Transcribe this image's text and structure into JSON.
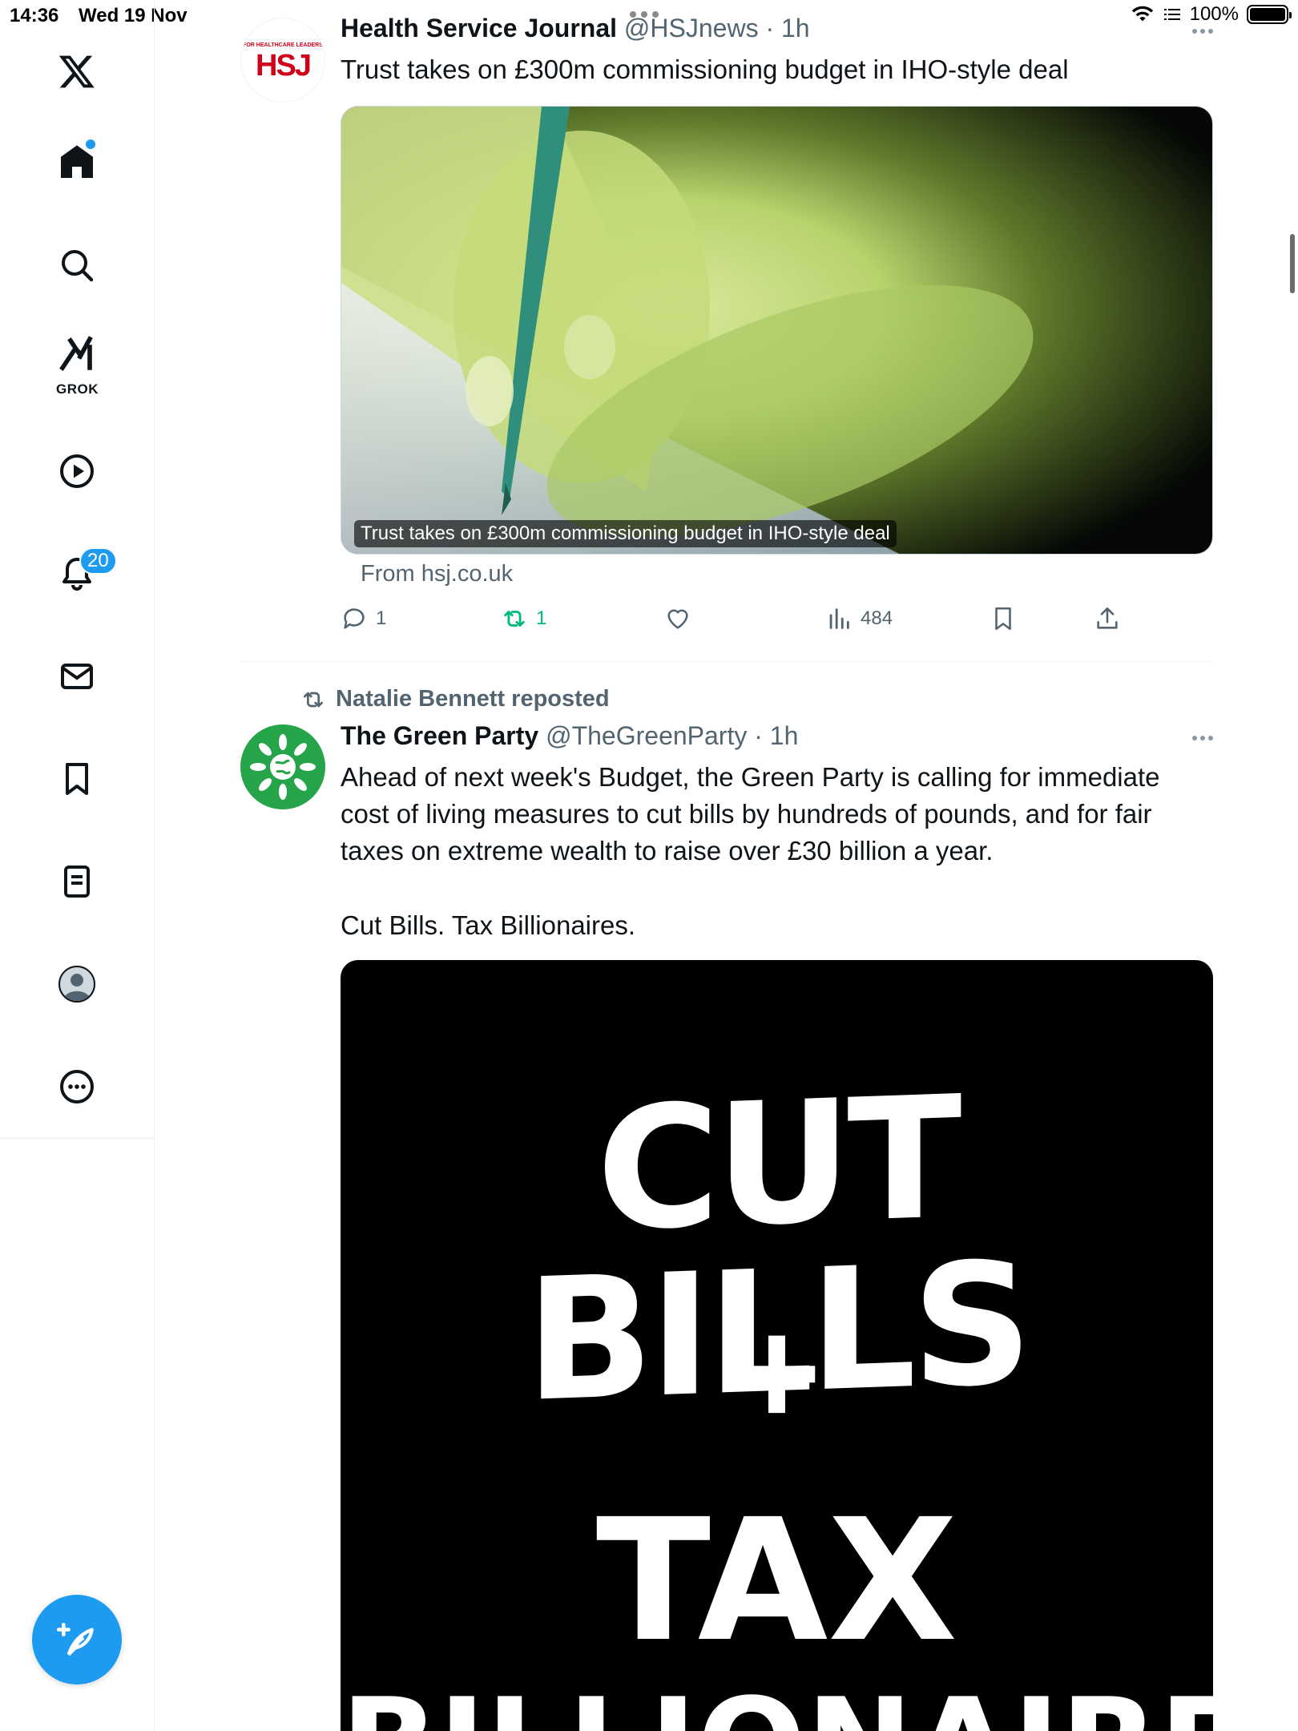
{
  "status_bar": {
    "time": "14:36",
    "date": "Wed 19 Nov",
    "battery": "100%"
  },
  "sidebar": {
    "grok_label": "GROK",
    "notifications_badge": "20",
    "items": [
      "x-logo",
      "home",
      "search",
      "grok",
      "videos",
      "notifications",
      "messages",
      "bookmarks",
      "lists",
      "profile",
      "more"
    ]
  },
  "tweets": [
    {
      "author_name": "Health Service Journal",
      "handle": "@HSJnews",
      "time": "· 1h",
      "avatar_text": "HSJ",
      "avatar_small": "FOR HEALTHCARE LEADERS",
      "text": "Trust takes on £300m commissioning budget in IHO-style deal",
      "card_caption": "Trust takes on £300m commissioning budget in IHO-style deal",
      "card_source": "From hsj.co.uk",
      "replies": "1",
      "reposts": "1",
      "views": "484"
    },
    {
      "reposted_by": "Natalie Bennett reposted",
      "author_name": "The Green Party",
      "handle": "@TheGreenParty",
      "time": "· 1h",
      "text_p1": "Ahead of next week's Budget, the Green Party is calling for immediate cost of living measures to cut bills by hundreds of pounds, and for fair taxes on extreme wealth to raise over £30 billion a year.",
      "text_p2": "Cut Bills. Tax Billionaires.",
      "poster_line1": "CUT BILLS",
      "poster_line2": "+",
      "poster_line3": "TAX",
      "poster_line4": "BILLIONAIRES"
    }
  ],
  "colors": {
    "accent": "#1d9bf0",
    "repost_green": "#00ba7c",
    "muted": "#536471",
    "hsj_red": "#d0021b",
    "green_party": "#26a44a"
  }
}
